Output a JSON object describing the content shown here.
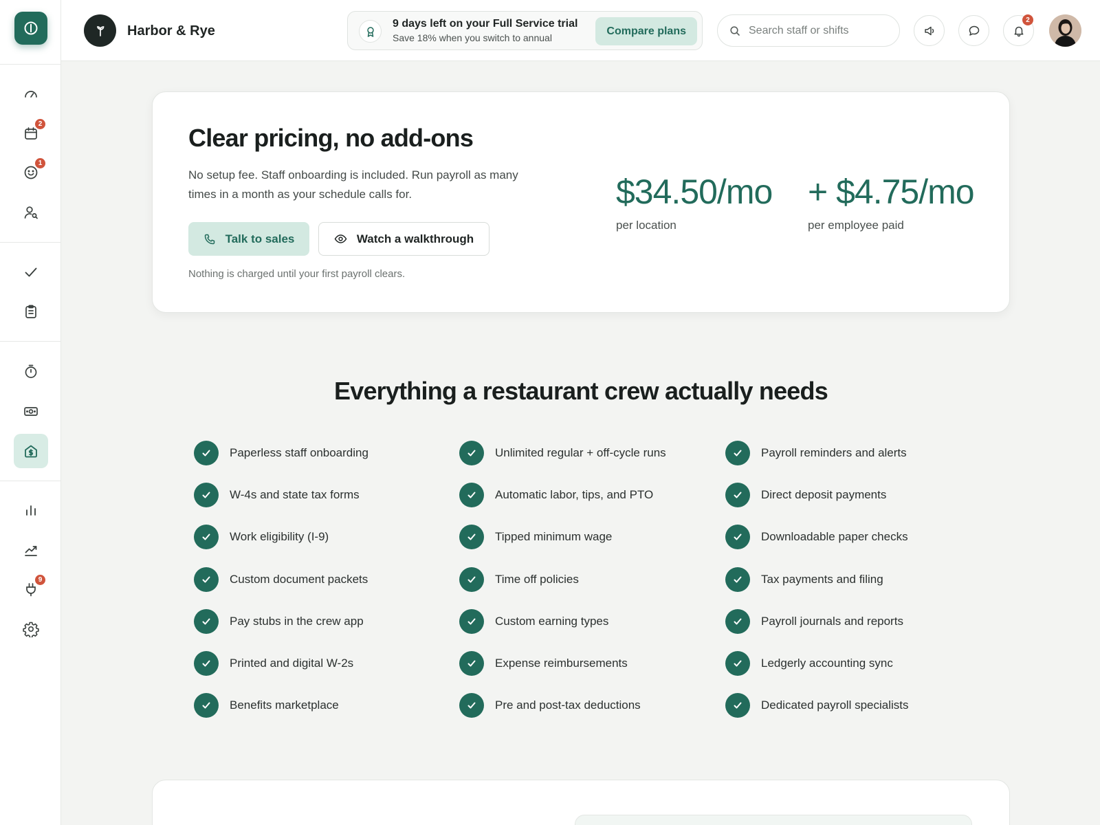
{
  "sidebar": {
    "items": [
      {
        "name": "dashboard",
        "icon": "gauge-icon",
        "badge": null
      },
      {
        "name": "schedule",
        "icon": "calendar-icon",
        "badge": "2"
      },
      {
        "name": "crew",
        "icon": "smiley-icon",
        "badge": "1"
      },
      {
        "name": "hiring",
        "icon": "user-search-icon",
        "badge": null
      },
      {
        "name": "tasks",
        "icon": "check-icon",
        "badge": null
      },
      {
        "name": "forms",
        "icon": "clipboard-icon",
        "badge": null
      },
      {
        "name": "time-clock",
        "icon": "stopwatch-icon",
        "badge": null
      },
      {
        "name": "tips",
        "icon": "cash-icon",
        "badge": null
      },
      {
        "name": "payroll",
        "icon": "money-house-icon",
        "badge": null,
        "active": true
      },
      {
        "name": "reports",
        "icon": "bar-chart-icon",
        "badge": null
      },
      {
        "name": "insights",
        "icon": "trend-icon",
        "badge": null
      },
      {
        "name": "integrations",
        "icon": "plug-icon",
        "badge": "9"
      },
      {
        "name": "settings",
        "icon": "gear-icon",
        "badge": null
      }
    ]
  },
  "header": {
    "brand_name": "Harbor & Rye",
    "trial_title": "9 days left on your Full Service trial",
    "trial_sub": "Save 18% when you switch to annual",
    "compare_label": "Compare plans",
    "search_placeholder": "Search staff or shifts",
    "notification_count": "2"
  },
  "pricing": {
    "title": "Clear pricing, no add-ons",
    "description": "No setup fee. Staff onboarding is included. Run payroll as many times in a month as your schedule calls for.",
    "talk_label": "Talk to sales",
    "walkthrough_label": "Watch a walkthrough",
    "note": "Nothing is charged until your first payroll clears.",
    "base_price": "$34.50/mo",
    "base_unit": "per location",
    "per_employee_price": "+ $4.75/mo",
    "per_employee_unit": "per employee paid"
  },
  "features": {
    "title": "Everything a restaurant crew actually needs",
    "columns": [
      [
        "Paperless staff onboarding",
        "W-4s and state tax forms",
        "Work eligibility (I-9)",
        "Custom document packets",
        "Pay stubs in the crew app",
        "Printed and digital W-2s",
        "Benefits marketplace"
      ],
      [
        "Unlimited regular + off-cycle runs",
        "Automatic labor, tips, and PTO",
        "Tipped minimum wage",
        "Time off policies",
        "Custom earning types",
        "Expense reimbursements",
        "Pre and post-tax deductions"
      ],
      [
        "Payroll reminders and alerts",
        "Direct deposit payments",
        "Downloadable paper checks",
        "Tax payments and filing",
        "Payroll journals and reports",
        "Ledgerly accounting sync",
        "Dedicated payroll specialists"
      ]
    ]
  },
  "colors": {
    "accent": "#226b5b",
    "accent_soft": "#d3e9e1",
    "badge": "#d0543c",
    "background": "#f3f4f2"
  }
}
